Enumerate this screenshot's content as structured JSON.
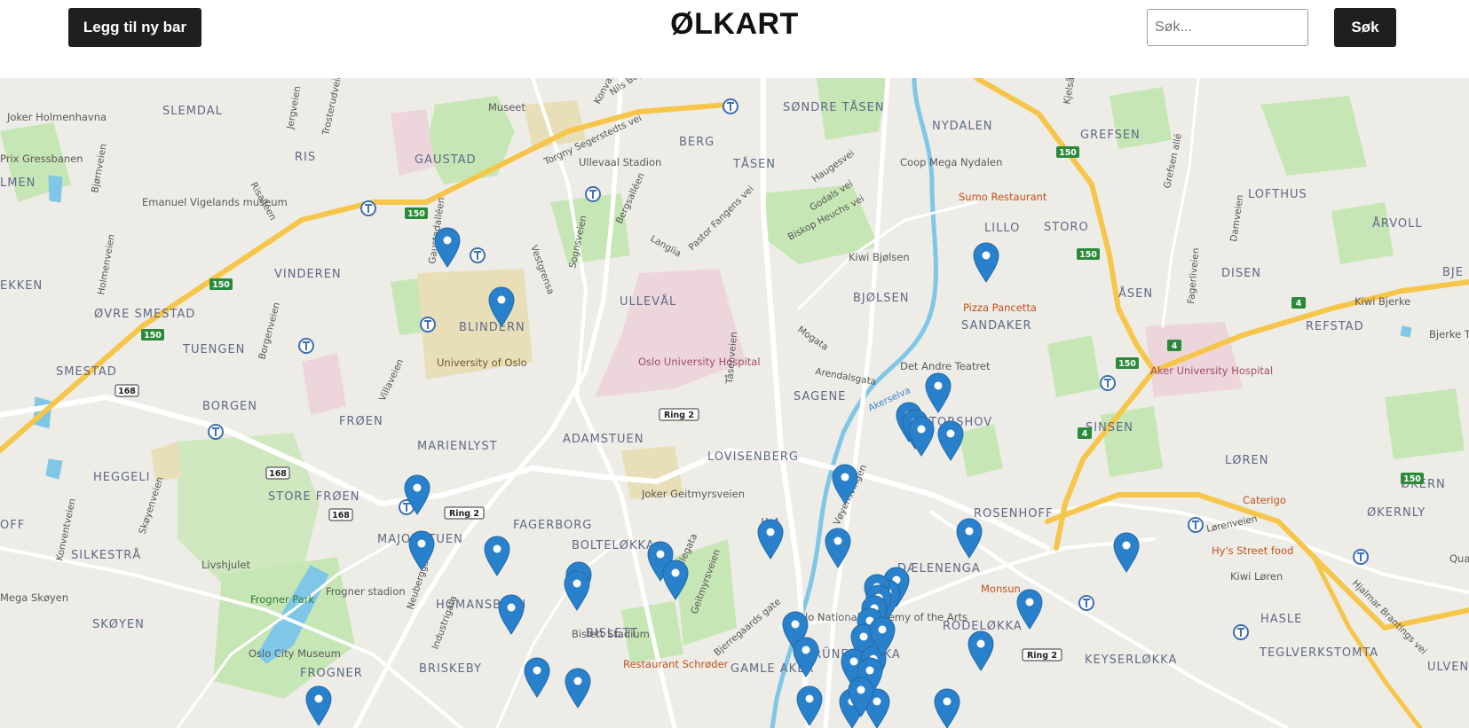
{
  "header": {
    "add_button": "Legg til ny bar",
    "title": "ØLKART",
    "search_placeholder": "Søk...",
    "search_button": "Søk"
  },
  "map": {
    "district_labels": [
      "SLEMDAL",
      "RIS",
      "GAUSTAD",
      "BERG",
      "SØNDRE TÅSEN",
      "TÅSEN",
      "NYDALEN",
      "GREFSEN",
      "LOFTHUS",
      "ÅRVOLL",
      "VINDEREN",
      "BLINDERN",
      "ULLEVÅL",
      "BJØLSEN",
      "LILLO",
      "STORO",
      "DISEN",
      "ÅSEN",
      "SANDAKER",
      "REFSTAD",
      "ØVRE SMESTAD",
      "TUENGEN",
      "SMESTAD",
      "BORGEN",
      "FRØEN",
      "SAGENE",
      "TORSHOV",
      "SINSEN",
      "MARIENLYST",
      "ADAMSTUEN",
      "LOVISENBERG",
      "HEGGELI",
      "STORE FRØEN",
      "LØREN",
      "ØKERN",
      "MAJORSTUEN",
      "FAGERBORG",
      "BOLTELØKKA",
      "ROSENHOFF",
      "ØKERNLY",
      "SILKESTRÅ",
      "DÆLENENGA",
      "HOMANSBYEN",
      "BISLETT",
      "RODELØKKA",
      "HASLE",
      "SKØYEN",
      "FROGNER",
      "BRISKEBY",
      "GAMLE AKER",
      "GRÜNERLØKKA",
      "KEYSERLØKKA",
      "TEGLVERKSTOMTA",
      "ULVEN",
      "EKKEN",
      "LMEN",
      "OFF",
      "BJE",
      "ILA"
    ],
    "poi_labels": [
      "Joker Holmenhavna",
      "Prix Gressbanen",
      "Museet",
      "Ullevaal Stadion",
      "Emanuel Vigelands museum",
      "University of Oslo",
      "Oslo University Hospital",
      "Coop Mega Nydalen",
      "Sumo Restaurant",
      "Kiwi Bjølsen",
      "Pizza Pancetta",
      "Det Andre Teatret",
      "Kiwi Bjerke",
      "Bjerke T",
      "Aker University Hospital",
      "Joker Geitmyrsveien",
      "Caterigo",
      "Hy's Street food",
      "Kiwi Løren",
      "Monsun",
      "Livshjulet",
      "Frogner stadion",
      "Frogner Park",
      "Oslo City Museum",
      "Bislett Stadium",
      "Restaurant Schrøder",
      "Oslo National Academy of the Arts",
      "Mega Skøyen",
      "Qua"
    ],
    "road_labels": [
      "Torgny Segerstedts vei",
      "Konvalveien",
      "Nils Bays vei",
      "Jergveien",
      "Trosterudveien",
      "Gaustadalléen",
      "Vestgrensa",
      "Sognsveien",
      "Bergsalléen",
      "Langlia",
      "Pastor Fangens vei",
      "Haugesvei",
      "Godals vei",
      "Biskop Heuchs vei",
      "Risalléen",
      "Bjørnveien",
      "Holmenveien",
      "Borgenveien",
      "Villaveien",
      "Mogata",
      "Arendalsgata",
      "Tåsenveien",
      "Akerselva",
      "Grefsen allé",
      "Damveien",
      "Fagerliveien",
      "Vøyensvingen",
      "Vallegata",
      "Geitmyrsveien",
      "Bjerregaards gate",
      "Neuberggata",
      "Industrigata",
      "Konventveien",
      "Skøyenveien",
      "Lørenveien",
      "Hjalmar Brantings vei",
      "Ring 2",
      "Kjelsåsveien"
    ],
    "road_shields": [
      "150",
      "150",
      "150",
      "150",
      "150",
      "150",
      "150",
      "168",
      "168",
      "168",
      "Ring 2",
      "Ring 2",
      "Ring 2",
      "4",
      "4",
      "4"
    ],
    "marker_count": 44
  }
}
